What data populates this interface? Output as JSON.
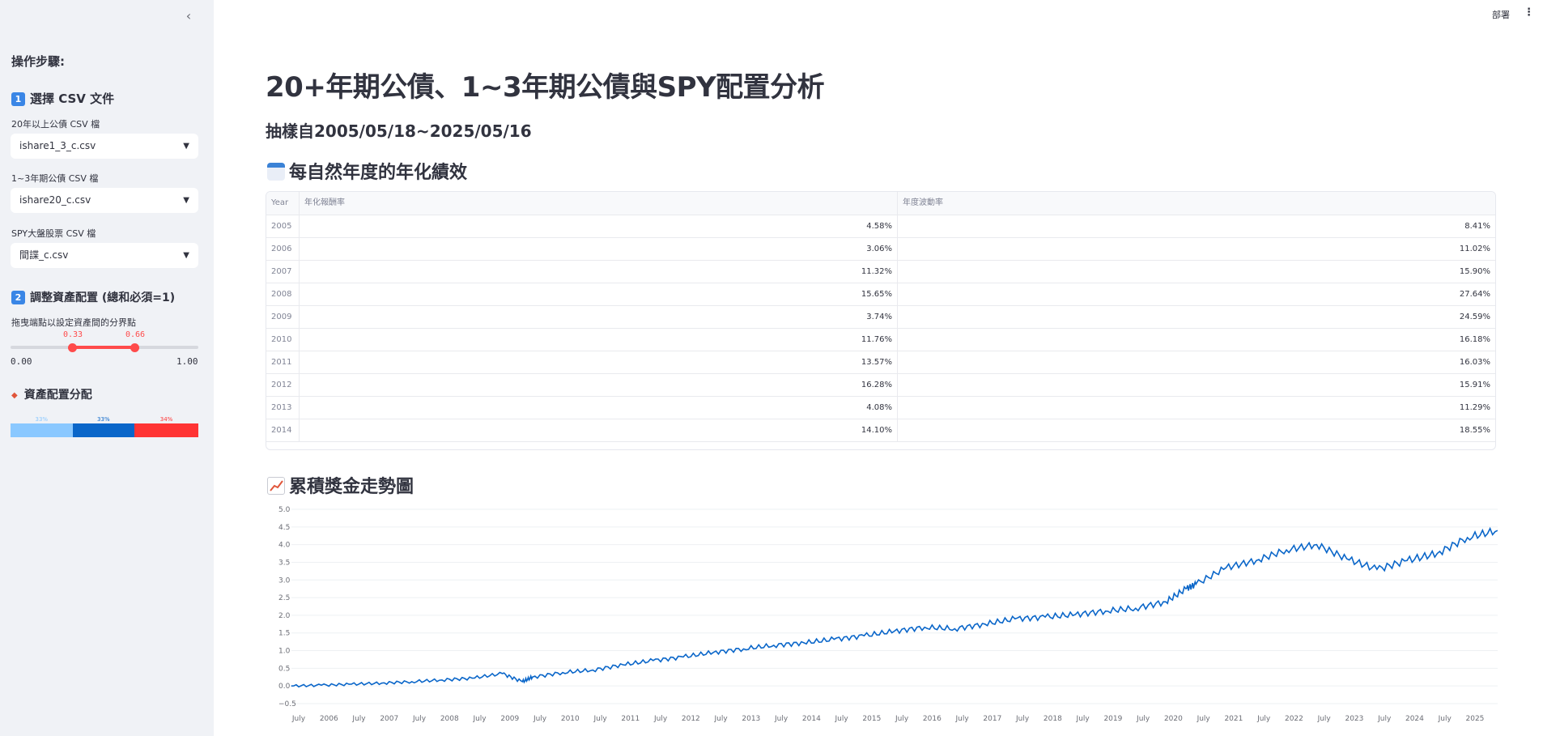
{
  "sidebar": {
    "steps_heading": "操作步驟:",
    "step1": {
      "badge": "1",
      "title": "選擇 CSV 文件"
    },
    "fields": [
      {
        "label": "20年以上公債 CSV 檔",
        "value": "ishare1_3_c.csv"
      },
      {
        "label": "1~3年期公債 CSV 檔",
        "value": "ishare20_c.csv"
      },
      {
        "label": "SPY大盤股票 CSV 檔",
        "value": "間諜_c.csv"
      }
    ],
    "step2": {
      "badge": "2",
      "title": "調整資產配置 (總和必須=1)"
    },
    "slider": {
      "label": "拖曳端點以設定資產間的分界點",
      "low": "0.33",
      "high": "0.66",
      "min": "0.00",
      "max": "1.00"
    },
    "allocation": {
      "title": "資產配置分配",
      "segments": [
        {
          "pct": "33%",
          "fraction": 0.33,
          "color": "#8ac8ff"
        },
        {
          "pct": "33%",
          "fraction": 0.33,
          "color": "#0a66c9"
        },
        {
          "pct": "34%",
          "fraction": 0.34,
          "color": "#ff3434"
        }
      ]
    }
  },
  "header": {
    "deploy": "部署",
    "menu_icon": "kebab-menu-icon"
  },
  "main": {
    "title": "20+年期公債、1~3年期公債與SPY配置分析",
    "subtitle": "抽樣自2005/05/18~2025/05/16",
    "table_section": "每自然年度的年化績效",
    "chart_section": "累積獎金走勢圖"
  },
  "table": {
    "columns": [
      "Year",
      "年化報酬率",
      "年度波動率"
    ],
    "rows": [
      [
        "2005",
        "4.58%",
        "8.41%"
      ],
      [
        "2006",
        "3.06%",
        "11.02%"
      ],
      [
        "2007",
        "11.32%",
        "15.90%"
      ],
      [
        "2008",
        "15.65%",
        "27.64%"
      ],
      [
        "2009",
        "3.74%",
        "24.59%"
      ],
      [
        "2010",
        "11.76%",
        "16.18%"
      ],
      [
        "2011",
        "13.57%",
        "16.03%"
      ],
      [
        "2012",
        "16.28%",
        "15.91%"
      ],
      [
        "2013",
        "4.08%",
        "11.29%"
      ],
      [
        "2014",
        "14.10%",
        "18.55%"
      ]
    ]
  },
  "chart_data": {
    "type": "line",
    "title": "",
    "xlabel": "",
    "ylabel": "",
    "ylim": [
      -0.5,
      5.0
    ],
    "yticks": [
      "5.0",
      "4.5",
      "4.0",
      "3.5",
      "3.0",
      "2.5",
      "2.0",
      "1.5",
      "1.0",
      "0.5",
      "0.0",
      "−0.5"
    ],
    "xticks": [
      "July",
      "2006",
      "July",
      "2007",
      "July",
      "2008",
      "July",
      "2009",
      "July",
      "2010",
      "July",
      "2011",
      "July",
      "2012",
      "July",
      "2013",
      "July",
      "2014",
      "July",
      "2015",
      "July",
      "2016",
      "July",
      "2017",
      "July",
      "2018",
      "July",
      "2019",
      "July",
      "2020",
      "July",
      "2021",
      "July",
      "2022",
      "July",
      "2023",
      "July",
      "2024",
      "July",
      "2025"
    ],
    "color": "#0a66c9",
    "grid": true,
    "series": [
      {
        "x": [
          "2005-05",
          "2005-11",
          "2006-05",
          "2006-11",
          "2007-05",
          "2007-11",
          "2008-05",
          "2008-11",
          "2009-03",
          "2009-05",
          "2009-11",
          "2010-05",
          "2010-11",
          "2011-05",
          "2011-11",
          "2012-05",
          "2012-11",
          "2013-05",
          "2013-11",
          "2014-05",
          "2014-11",
          "2015-05",
          "2015-11",
          "2016-05",
          "2016-11",
          "2017-05",
          "2017-11",
          "2018-05",
          "2018-11",
          "2019-05",
          "2019-11",
          "2020-03",
          "2020-05",
          "2020-11",
          "2021-05",
          "2021-11",
          "2022-05",
          "2022-11",
          "2023-05",
          "2023-11",
          "2024-05",
          "2024-11",
          "2025-05"
        ],
        "values": [
          0.0,
          0.02,
          0.05,
          0.08,
          0.12,
          0.17,
          0.22,
          0.35,
          0.12,
          0.25,
          0.38,
          0.45,
          0.6,
          0.72,
          0.82,
          0.95,
          1.05,
          1.15,
          1.22,
          1.32,
          1.42,
          1.55,
          1.66,
          1.62,
          1.75,
          1.9,
          1.95,
          2.02,
          2.12,
          2.2,
          2.38,
          2.75,
          2.88,
          3.35,
          3.55,
          3.85,
          4.0,
          3.6,
          3.3,
          3.55,
          3.75,
          4.2,
          4.4
        ]
      }
    ]
  }
}
